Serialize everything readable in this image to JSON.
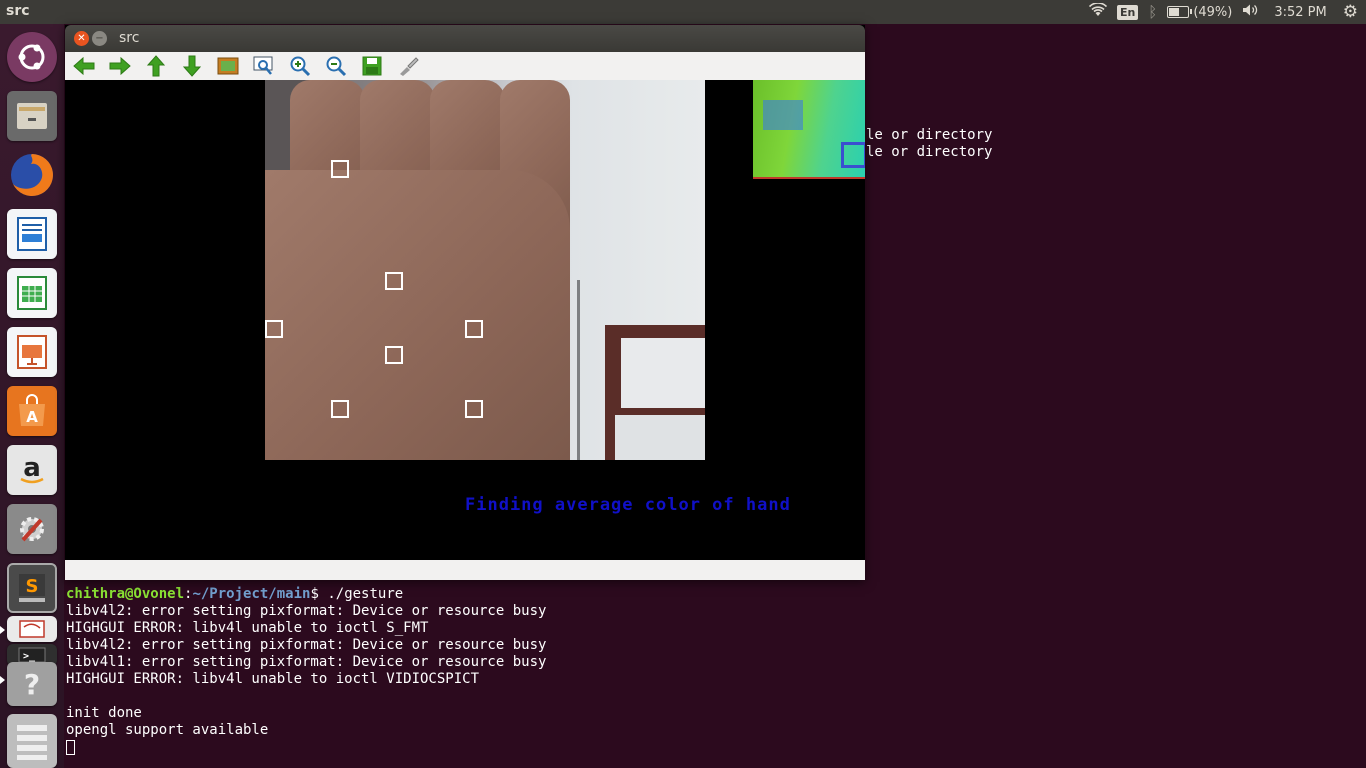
{
  "panel": {
    "app_title": "src",
    "keyboard_layout": "En",
    "battery_level": 0.49,
    "battery_text": "(49%)",
    "time": "3:52 PM"
  },
  "launcher": {
    "items": [
      {
        "name": "ubuntu-dash",
        "color": "#7a3a63"
      },
      {
        "name": "files",
        "color": "#6a6a6a"
      },
      {
        "name": "firefox",
        "color": "#e66000"
      },
      {
        "name": "libreoffice-writer",
        "color": "#1f5fa8"
      },
      {
        "name": "libreoffice-calc",
        "color": "#2a8a3a"
      },
      {
        "name": "libreoffice-impress",
        "color": "#c5532a"
      },
      {
        "name": "software-center",
        "color": "#e7751f"
      },
      {
        "name": "amazon",
        "color": "#d9d9d9"
      },
      {
        "name": "system-settings",
        "color": "#7a7a7a"
      },
      {
        "name": "sublime-text",
        "color": "#666666"
      },
      {
        "name": "text-editor",
        "color": "#e9e9e9"
      },
      {
        "name": "terminal",
        "color": "#3a3a3a"
      },
      {
        "name": "help",
        "color": "#9a9a9a"
      },
      {
        "name": "workspace-switcher",
        "color": "#bdbdbd"
      }
    ]
  },
  "terminal": {
    "prompt_user": "chithra@Ovonel",
    "prompt_sep": ":",
    "prompt_path": "~/Project/main",
    "prompt_symbol": "$",
    "command": " ./gesture",
    "lines": [
      "libv4l2: error setting pixformat: Device or resource busy",
      "HIGHGUI ERROR: libv4l unable to ioctl S_FMT",
      "libv4l2: error setting pixformat: Device or resource busy",
      "libv4l1: error setting pixformat: Device or resource busy",
      "HIGHGUI ERROR: libv4l unable to ioctl VIDIOCSPICT",
      "",
      "init done",
      "opengl support available"
    ],
    "behind_lines": [
      "le or directory",
      "le or directory"
    ]
  },
  "window": {
    "title": "src",
    "toolbar": [
      "pan-left",
      "pan-right",
      "pan-up",
      "pan-down",
      "zoom-fit",
      "zoom-region",
      "zoom-in",
      "zoom-out",
      "save",
      "properties"
    ],
    "overlay_text": "Finding average color of hand"
  }
}
